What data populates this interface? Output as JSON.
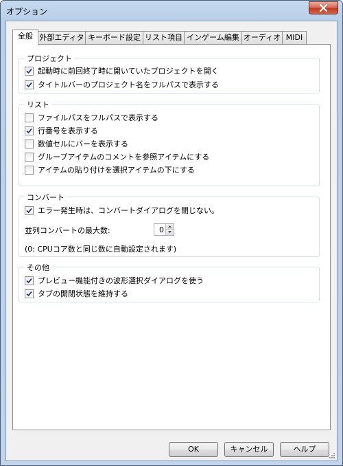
{
  "window": {
    "title": "オプション"
  },
  "tabs": [
    {
      "label": "全般",
      "active": true
    },
    {
      "label": "外部エディタ",
      "active": false
    },
    {
      "label": "キーボード設定",
      "active": false
    },
    {
      "label": "リスト項目",
      "active": false
    },
    {
      "label": "インゲーム編集",
      "active": false
    },
    {
      "label": "オーディオ",
      "active": false
    },
    {
      "label": "MIDI",
      "active": false
    }
  ],
  "groups": {
    "project": {
      "title": "プロジェクト",
      "items": [
        {
          "label": "起動時に前回終了時に開いていたプロジェクトを開く",
          "checked": true
        },
        {
          "label": "タイトルバーのプロジェクト名をフルパスで表示する",
          "checked": true
        }
      ]
    },
    "list": {
      "title": "リスト",
      "items": [
        {
          "label": "ファイルパスをフルパスで表示する",
          "checked": false
        },
        {
          "label": "行番号を表示する",
          "checked": true
        },
        {
          "label": "数値セルにバーを表示する",
          "checked": false
        },
        {
          "label": "グループアイテムのコメントを参照アイテムにする",
          "checked": false
        },
        {
          "label": "アイテムの貼り付けを選択アイテムの下にする",
          "checked": false
        }
      ]
    },
    "convert": {
      "title": "コンバート",
      "items": [
        {
          "label": "エラー発生時は、コンバートダイアログを閉じない。",
          "checked": true
        }
      ],
      "parallel_label": "並列コンバートの最大数:",
      "parallel_value": "0",
      "note": "(0: CPUコア数と同じ数に自動設定されます)"
    },
    "other": {
      "title": "その他",
      "items": [
        {
          "label": "プレビュー機能付きの波形選択ダイアログを使う",
          "checked": true
        },
        {
          "label": "タブの開閉状態を維持する",
          "checked": true
        }
      ]
    }
  },
  "buttons": {
    "ok": "OK",
    "cancel": "キャンセル",
    "help": "ヘルプ"
  }
}
